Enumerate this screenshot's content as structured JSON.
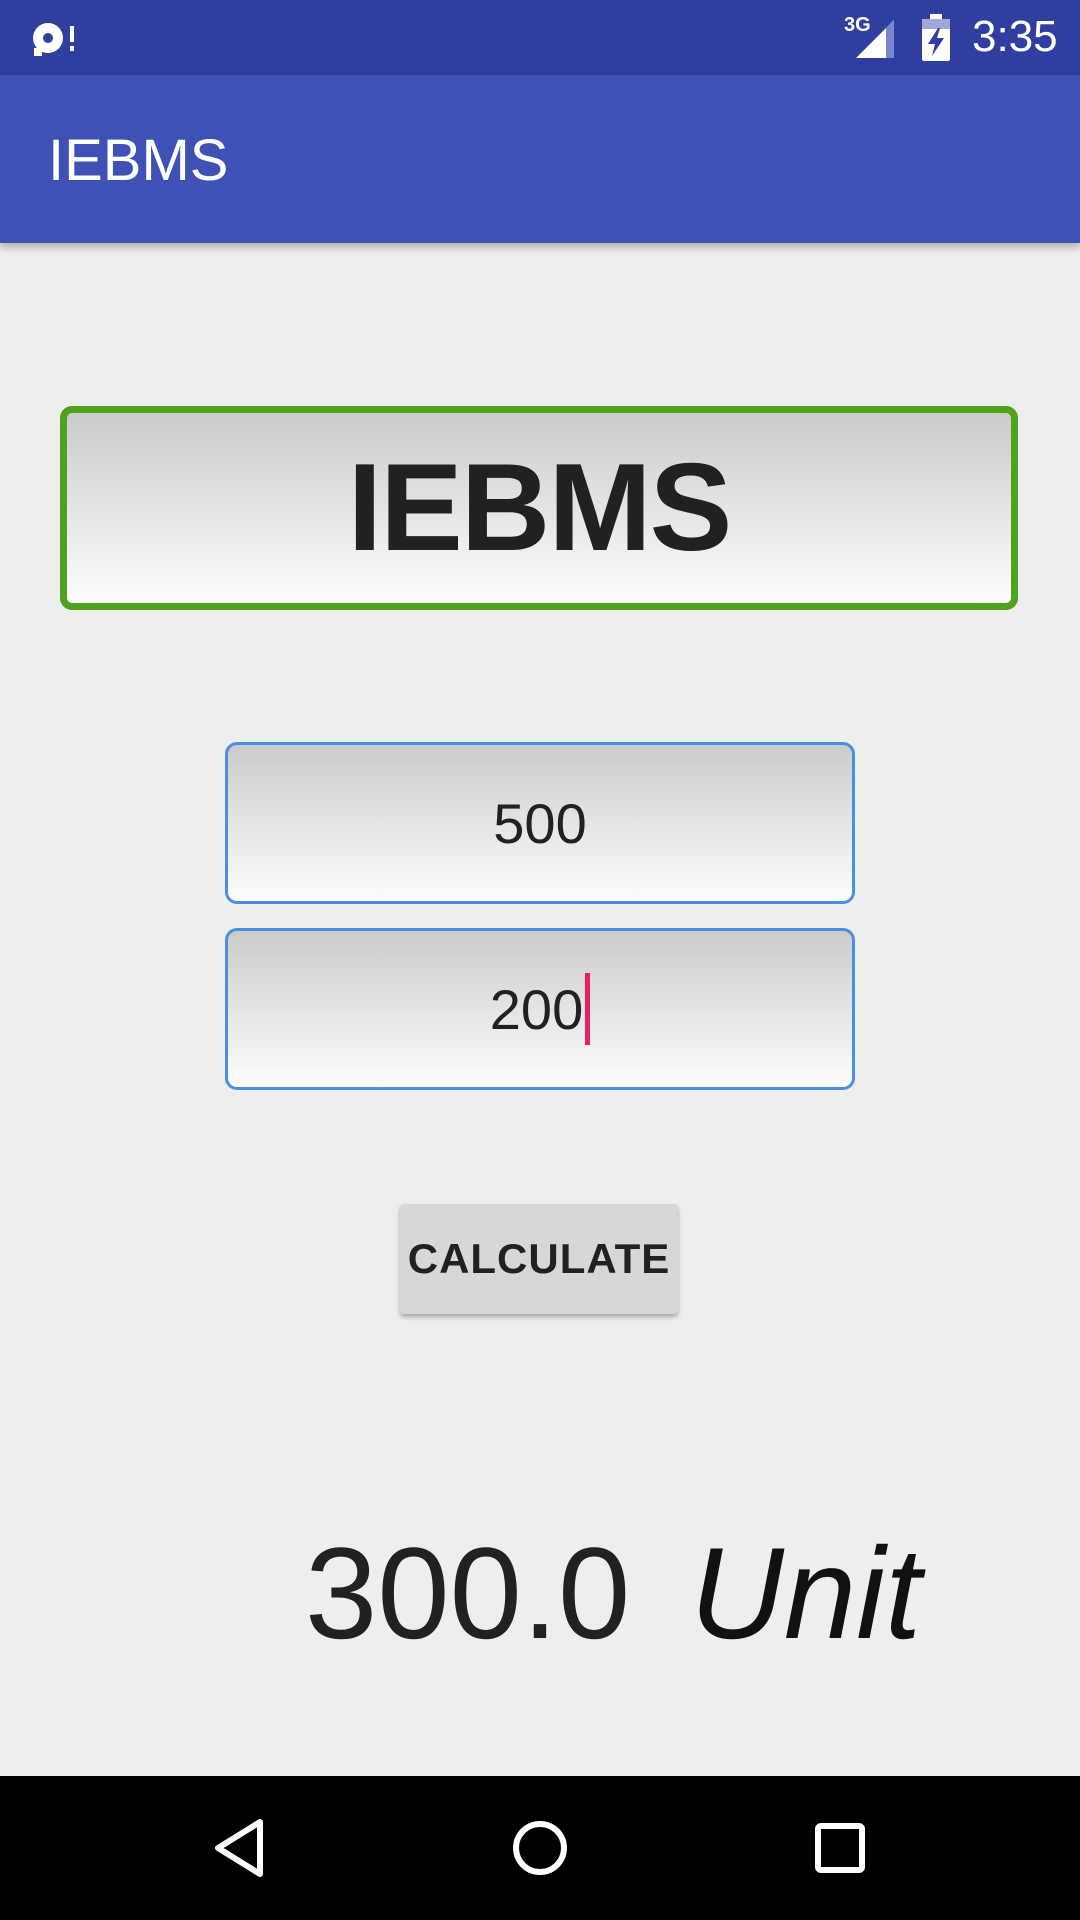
{
  "status_bar": {
    "network_label": "3G",
    "time": "3:35",
    "icons": [
      "notification-icon",
      "signal-icon",
      "battery-charging-icon"
    ]
  },
  "app_bar": {
    "title": "IEBMS"
  },
  "main": {
    "header_label": "IEBMS",
    "input_1_value": "500",
    "input_2_value": "200",
    "calculate_label": "CALCULATE",
    "result_value": "300.0",
    "result_unit": "Unit"
  },
  "nav_bar": {
    "icons": [
      "back-icon",
      "home-icon",
      "recent-apps-icon"
    ]
  },
  "colors": {
    "status_bar": "#303f9f",
    "app_bar": "#3f51b5",
    "title_border": "#4fa21b",
    "input_border": "#4a90e2",
    "cursor": "#e91e63",
    "button": "#d6d7d7"
  }
}
